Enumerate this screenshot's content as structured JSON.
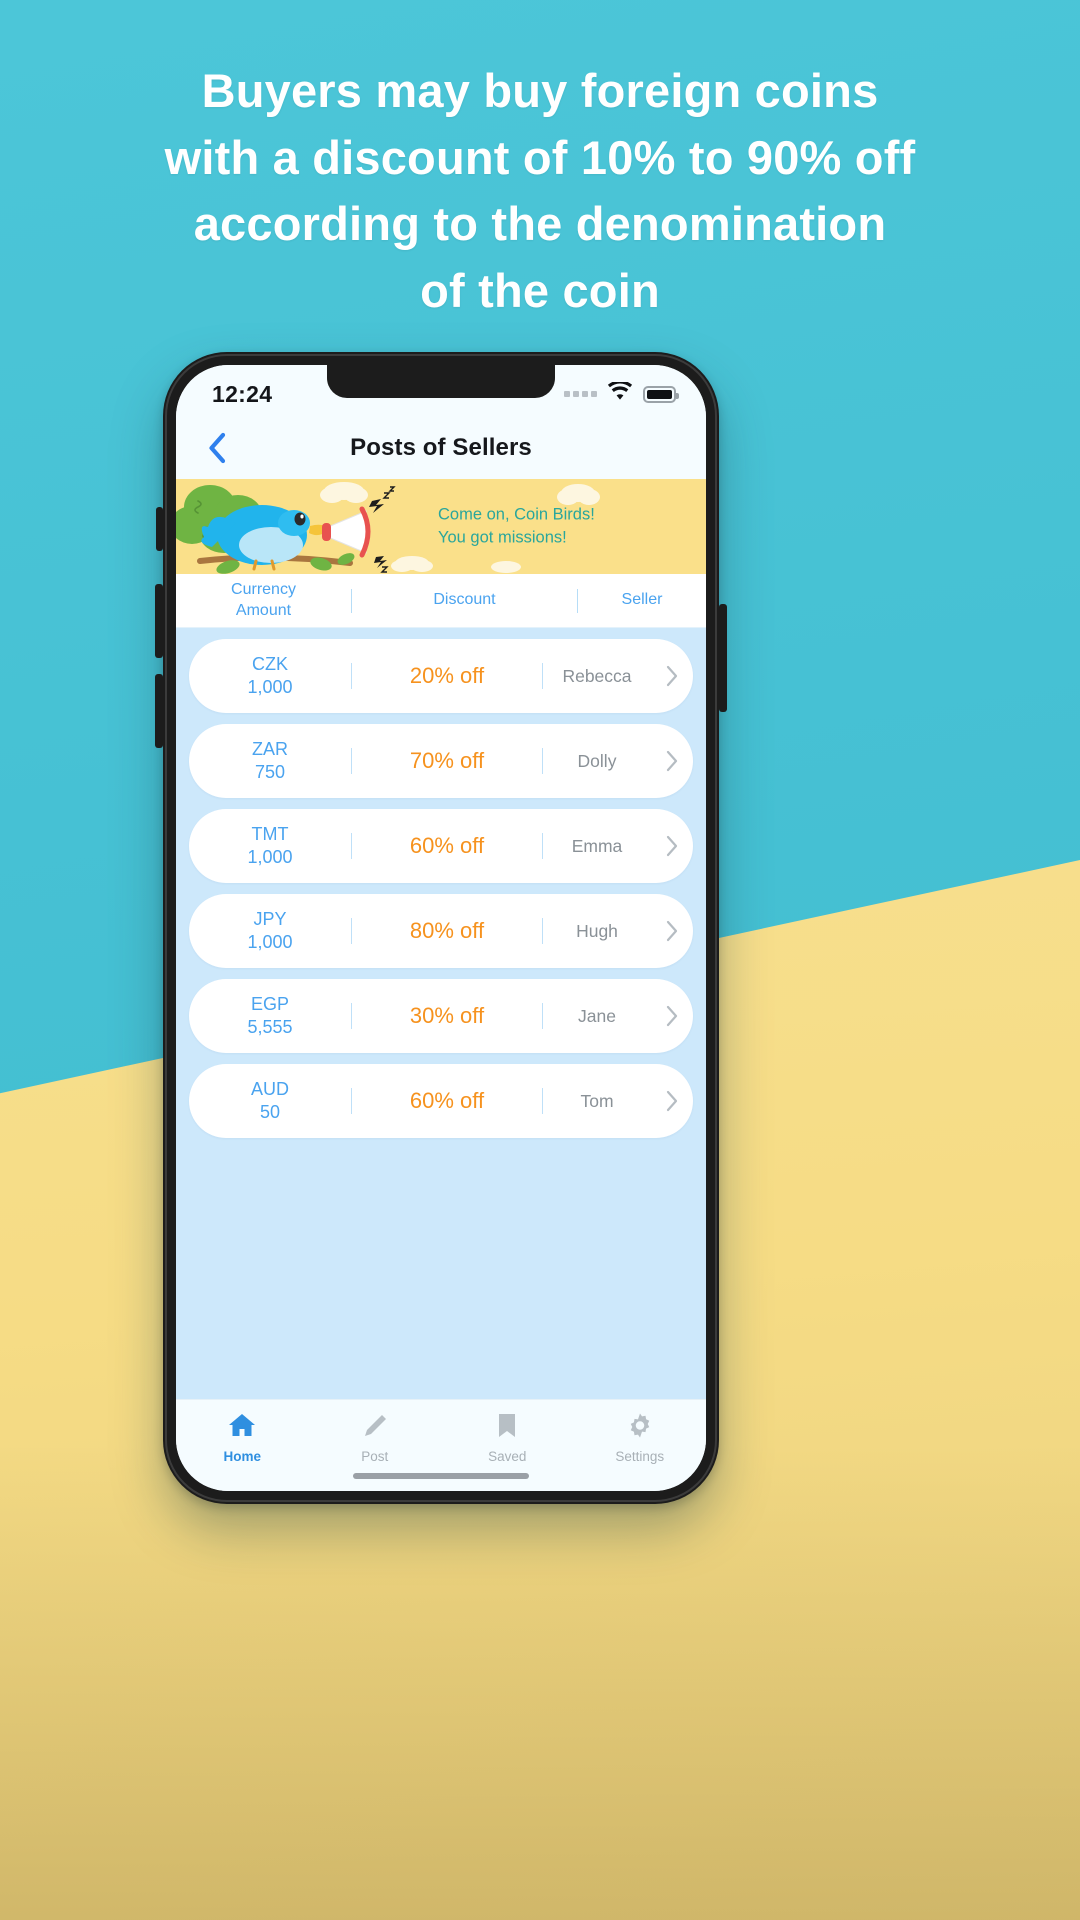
{
  "headline": {
    "lines": [
      "Buyers may buy foreign coins",
      "with a discount of 10% to 90% off",
      "according to the denomination",
      "of the coin"
    ]
  },
  "colors": {
    "background_teal": "#45c3d6",
    "background_yellow": "#f7df8e",
    "accent_blue": "#4aa3ef",
    "accent_orange": "#f6921e",
    "banner_yellow": "#fae08a",
    "banner_text_teal": "#2aa69c",
    "list_background": "#cde8fb"
  },
  "status_bar": {
    "time": "12:24",
    "signal_icon": "signal-dots-icon",
    "wifi_icon": "wifi-icon",
    "battery_icon": "battery-full-icon"
  },
  "nav": {
    "back_icon": "chevron-left-icon",
    "title": "Posts of Sellers"
  },
  "banner": {
    "bird_icon": "coin-bird-illustration",
    "megaphone_icon": "megaphone-icon",
    "line1": "Come on, Coin Birds!",
    "line2": "You got missions!"
  },
  "table": {
    "headers": {
      "currency": "Currency",
      "amount": "Amount",
      "discount": "Discount",
      "seller": "Seller"
    },
    "rows": [
      {
        "currency": "CZK",
        "amount": "1,000",
        "discount": "20% off",
        "seller": "Rebecca",
        "arrow_icon": "chevron-right-icon"
      },
      {
        "currency": "ZAR",
        "amount": "750",
        "discount": "70% off",
        "seller": "Dolly",
        "arrow_icon": "chevron-right-icon"
      },
      {
        "currency": "TMT",
        "amount": "1,000",
        "discount": "60% off",
        "seller": "Emma",
        "arrow_icon": "chevron-right-icon"
      },
      {
        "currency": "JPY",
        "amount": "1,000",
        "discount": "80% off",
        "seller": "Hugh",
        "arrow_icon": "chevron-right-icon"
      },
      {
        "currency": "EGP",
        "amount": "5,555",
        "discount": "30% off",
        "seller": "Jane",
        "arrow_icon": "chevron-right-icon"
      },
      {
        "currency": "AUD",
        "amount": "50",
        "discount": "60% off",
        "seller": "Tom",
        "arrow_icon": "chevron-right-icon"
      }
    ]
  },
  "tabs": [
    {
      "label": "Home",
      "icon": "home-icon",
      "active": true
    },
    {
      "label": "Post",
      "icon": "pencil-icon",
      "active": false
    },
    {
      "label": "Saved",
      "icon": "bookmark-icon",
      "active": false
    },
    {
      "label": "Settings",
      "icon": "gear-icon",
      "active": false
    }
  ]
}
